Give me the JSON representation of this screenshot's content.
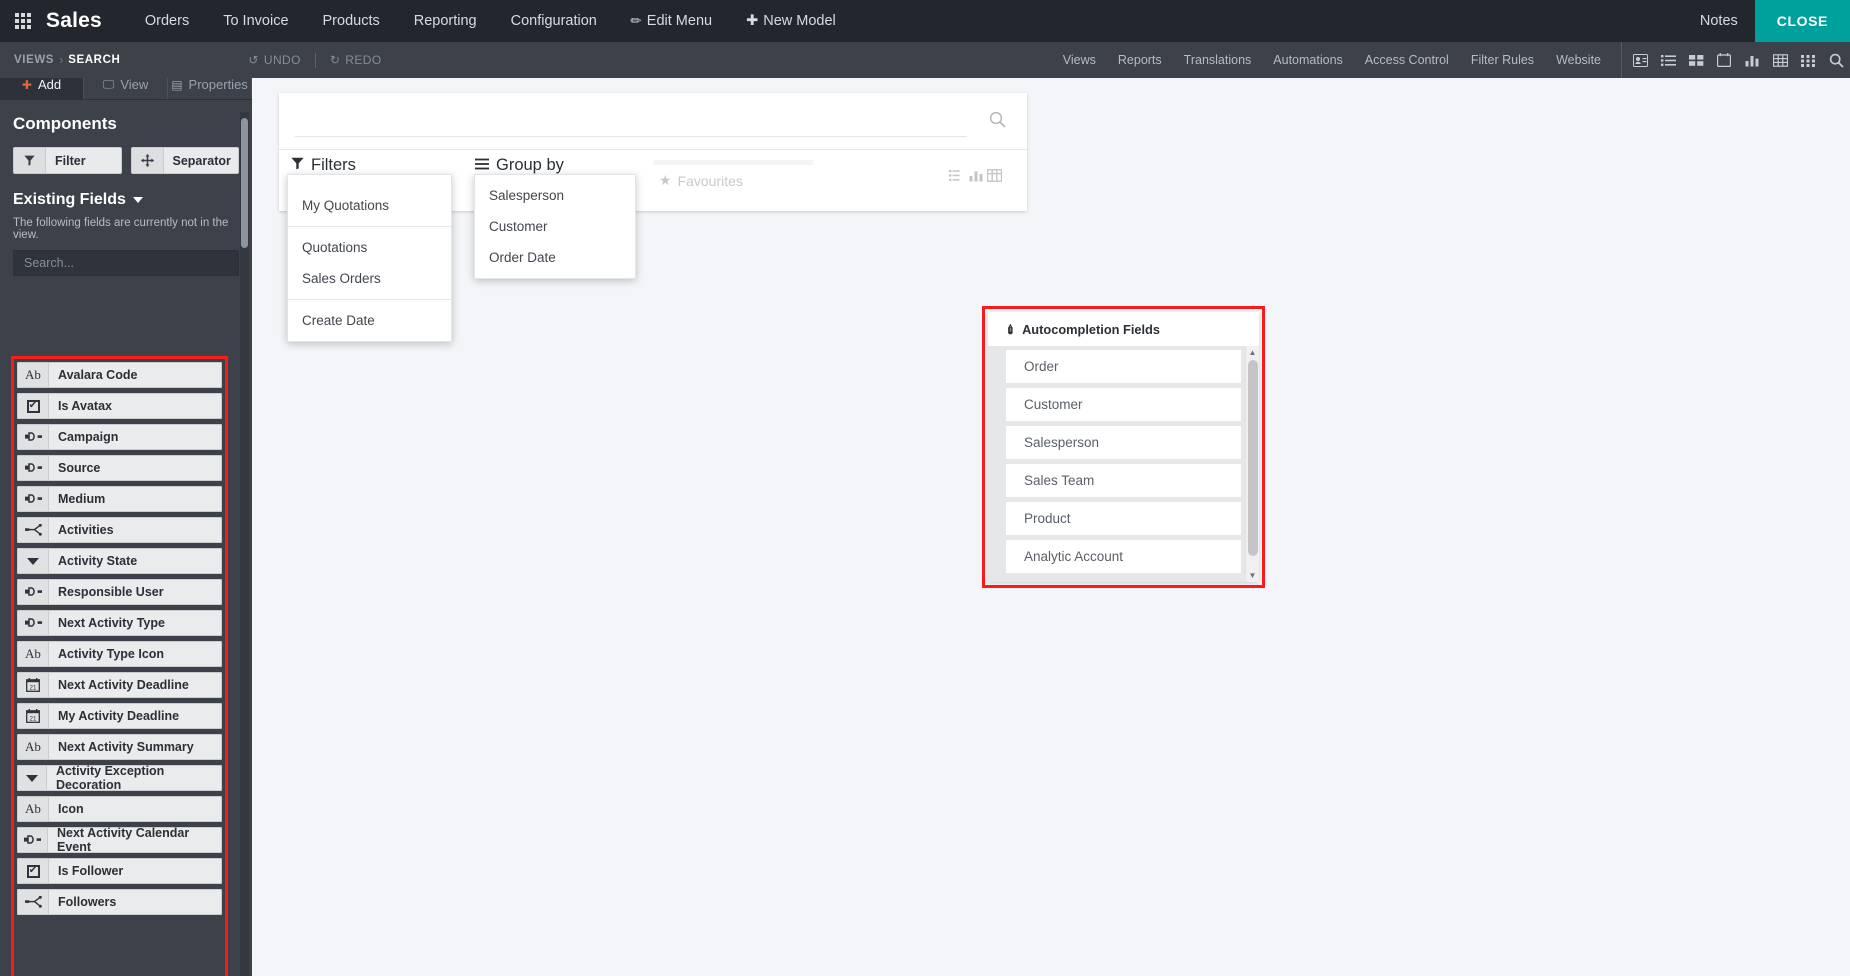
{
  "navbar": {
    "apps_icon": "apps-grid-icon",
    "brand": "Sales",
    "menus": [
      {
        "label": "Orders"
      },
      {
        "label": "To Invoice"
      },
      {
        "label": "Products"
      },
      {
        "label": "Reporting"
      },
      {
        "label": "Configuration"
      }
    ],
    "edit_menu": "Edit Menu",
    "new_model": "New Model",
    "notes": "Notes",
    "close": "CLOSE",
    "close_color": "#00a09d",
    "background": "#22272e"
  },
  "studiobar": {
    "breadcrumb_root": "VIEWS",
    "breadcrumb_separator": "›",
    "breadcrumb_current": "SEARCH",
    "undo": "UNDO",
    "redo": "REDO",
    "links": [
      {
        "label": "Views"
      },
      {
        "label": "Reports"
      },
      {
        "label": "Translations"
      },
      {
        "label": "Automations"
      },
      {
        "label": "Access Control"
      },
      {
        "label": "Filter Rules"
      },
      {
        "label": "Website"
      }
    ],
    "view_icons": [
      {
        "name": "contact-card-icon"
      },
      {
        "name": "list-view-icon"
      },
      {
        "name": "kanban-view-icon"
      },
      {
        "name": "calendar-view-icon"
      },
      {
        "name": "graph-view-icon"
      },
      {
        "name": "pivot-view-icon"
      },
      {
        "name": "activity-view-icon"
      },
      {
        "name": "search-view-icon"
      }
    ],
    "background": "#3c414a"
  },
  "sidebar": {
    "tabs": [
      {
        "label": "Add",
        "icon": "plus-icon",
        "active": true
      },
      {
        "label": "View",
        "icon": "display-icon",
        "active": false
      },
      {
        "label": "Properties",
        "icon": "properties-icon",
        "active": false
      }
    ],
    "components_title": "Components",
    "components": [
      {
        "label": "Filter",
        "icon": "filter-icon"
      },
      {
        "label": "Separator",
        "icon": "separator-icon"
      }
    ],
    "existing_fields_title": "Existing Fields",
    "existing_fields_note": "The following fields are currently not in the view.",
    "search_placeholder": "Search...",
    "search_value": "",
    "highlight_color": "#fc1a1a",
    "fields": [
      {
        "label": "Avalara Code",
        "icon": "char-field-icon",
        "glyph": "Ab"
      },
      {
        "label": "Is Avatax",
        "icon": "boolean-field-icon",
        "glyph": "checkbox"
      },
      {
        "label": "Campaign",
        "icon": "many2one-field-icon",
        "glyph": "m2o"
      },
      {
        "label": "Source",
        "icon": "many2one-field-icon",
        "glyph": "m2o"
      },
      {
        "label": "Medium",
        "icon": "many2one-field-icon",
        "glyph": "m2o"
      },
      {
        "label": "Activities",
        "icon": "one2many-field-icon",
        "glyph": "o2m"
      },
      {
        "label": "Activity State",
        "icon": "selection-field-icon",
        "glyph": "triangle"
      },
      {
        "label": "Responsible User",
        "icon": "many2one-field-icon",
        "glyph": "m2o"
      },
      {
        "label": "Next Activity Type",
        "icon": "many2one-field-icon",
        "glyph": "m2o"
      },
      {
        "label": "Activity Type Icon",
        "icon": "char-field-icon",
        "glyph": "Ab"
      },
      {
        "label": "Next Activity Deadline",
        "icon": "date-field-icon",
        "glyph": "calendar"
      },
      {
        "label": "My Activity Deadline",
        "icon": "date-field-icon",
        "glyph": "calendar"
      },
      {
        "label": "Next Activity Summary",
        "icon": "char-field-icon",
        "glyph": "Ab"
      },
      {
        "label": "Activity Exception Decoration",
        "icon": "selection-field-icon",
        "glyph": "triangle"
      },
      {
        "label": "Icon",
        "icon": "char-field-icon",
        "glyph": "Ab"
      },
      {
        "label": "Next Activity Calendar Event",
        "icon": "many2one-field-icon",
        "glyph": "m2o"
      },
      {
        "label": "Is Follower",
        "icon": "boolean-field-icon",
        "glyph": "checkbox"
      },
      {
        "label": "Followers",
        "icon": "one2many-field-icon",
        "glyph": "o2m"
      }
    ]
  },
  "search_view": {
    "search_placeholder": "",
    "favourites_label": "Favourites",
    "filters": {
      "label": "Filters",
      "icon": "filter-icon",
      "groups": [
        [
          "My Quotations"
        ],
        [
          "Quotations",
          "Sales Orders"
        ],
        [
          "Create Date"
        ]
      ]
    },
    "group_by": {
      "label": "Group by",
      "icon": "bars-icon",
      "items": [
        "Salesperson",
        "Customer",
        "Order Date"
      ]
    }
  },
  "autocompletion": {
    "title": "Autocompletion Fields",
    "icon": "magic-wand-icon",
    "highlight_color": "#fc1a1a",
    "items": [
      "Order",
      "Customer",
      "Salesperson",
      "Sales Team",
      "Product",
      "Analytic Account"
    ],
    "scroll_up": "▲",
    "scroll_down": "▼"
  }
}
